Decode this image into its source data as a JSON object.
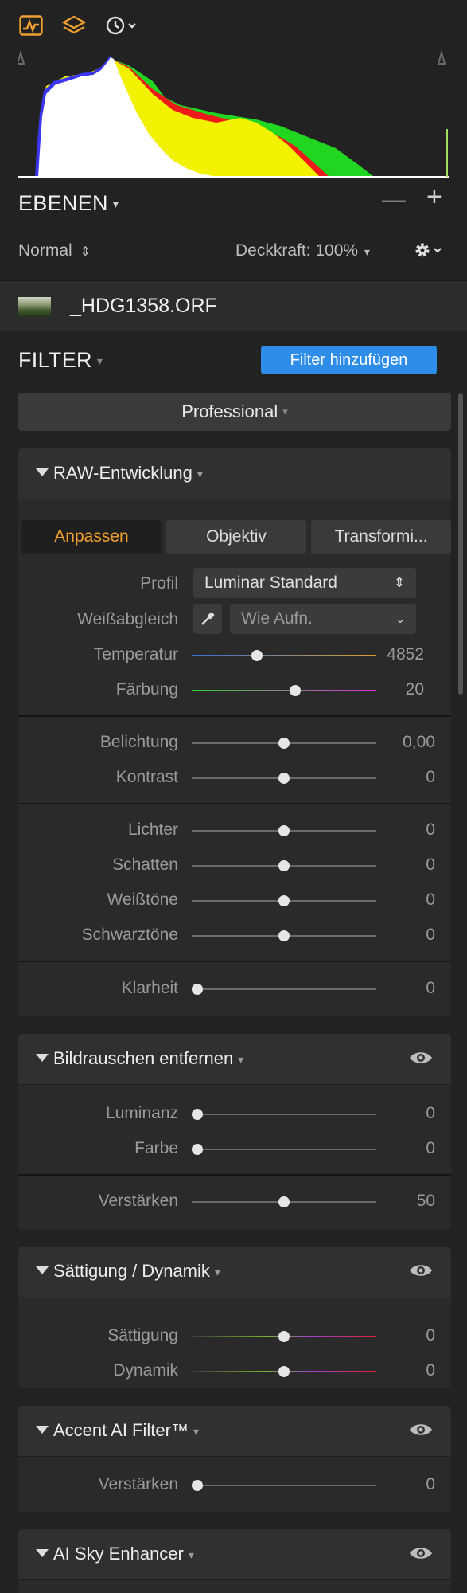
{
  "toolbar": {
    "icons": [
      "histogram-icon",
      "layers-icon",
      "history-icon"
    ]
  },
  "layers": {
    "title": "EBENEN",
    "blend_mode": "Normal",
    "opacity_label": "Deckkraft: 100%",
    "remove_symbol": "—",
    "add_symbol": "+"
  },
  "layer": {
    "name": "_HDG1358.ORF"
  },
  "filter": {
    "title": "FILTER",
    "add_button": "Filter hinzufügen",
    "workspace": "Professional"
  },
  "raw": {
    "title": "RAW-Entwicklung",
    "tabs": [
      "Anpassen",
      "Objektiv",
      "Transformi..."
    ],
    "profile_label": "Profil",
    "profile_value": "Luminar Standard",
    "wb_label": "Weißabgleich",
    "wb_value": "Wie Aufn.",
    "sliders": [
      {
        "label": "Temperatur",
        "value": "4852"
      },
      {
        "label": "Färbung",
        "value": "20"
      },
      {
        "label": "Belichtung",
        "value": "0,00"
      },
      {
        "label": "Kontrast",
        "value": "0"
      },
      {
        "label": "Lichter",
        "value": "0"
      },
      {
        "label": "Schatten",
        "value": "0"
      },
      {
        "label": "Weißtöne",
        "value": "0"
      },
      {
        "label": "Schwarztöne",
        "value": "0"
      },
      {
        "label": "Klarheit",
        "value": "0"
      }
    ]
  },
  "noise": {
    "title": "Bildrauschen entfernen",
    "sliders": [
      {
        "label": "Luminanz",
        "value": "0"
      },
      {
        "label": "Farbe",
        "value": "0"
      },
      {
        "label": "Verstärken",
        "value": "50"
      }
    ]
  },
  "saturation": {
    "title": "Sättigung / Dynamik",
    "sliders": [
      {
        "label": "Sättigung",
        "value": "0"
      },
      {
        "label": "Dynamik",
        "value": "0"
      }
    ]
  },
  "accent": {
    "title": "Accent AI Filter™",
    "sliders": [
      {
        "label": "Verstärken",
        "value": "0"
      }
    ]
  },
  "sky": {
    "title": "AI Sky Enhancer"
  },
  "colors": {
    "accent_orange": "#f0a030",
    "button_blue": "#2e8de8",
    "panel_bg": "#2a2a2a",
    "header_bg": "#303030"
  }
}
